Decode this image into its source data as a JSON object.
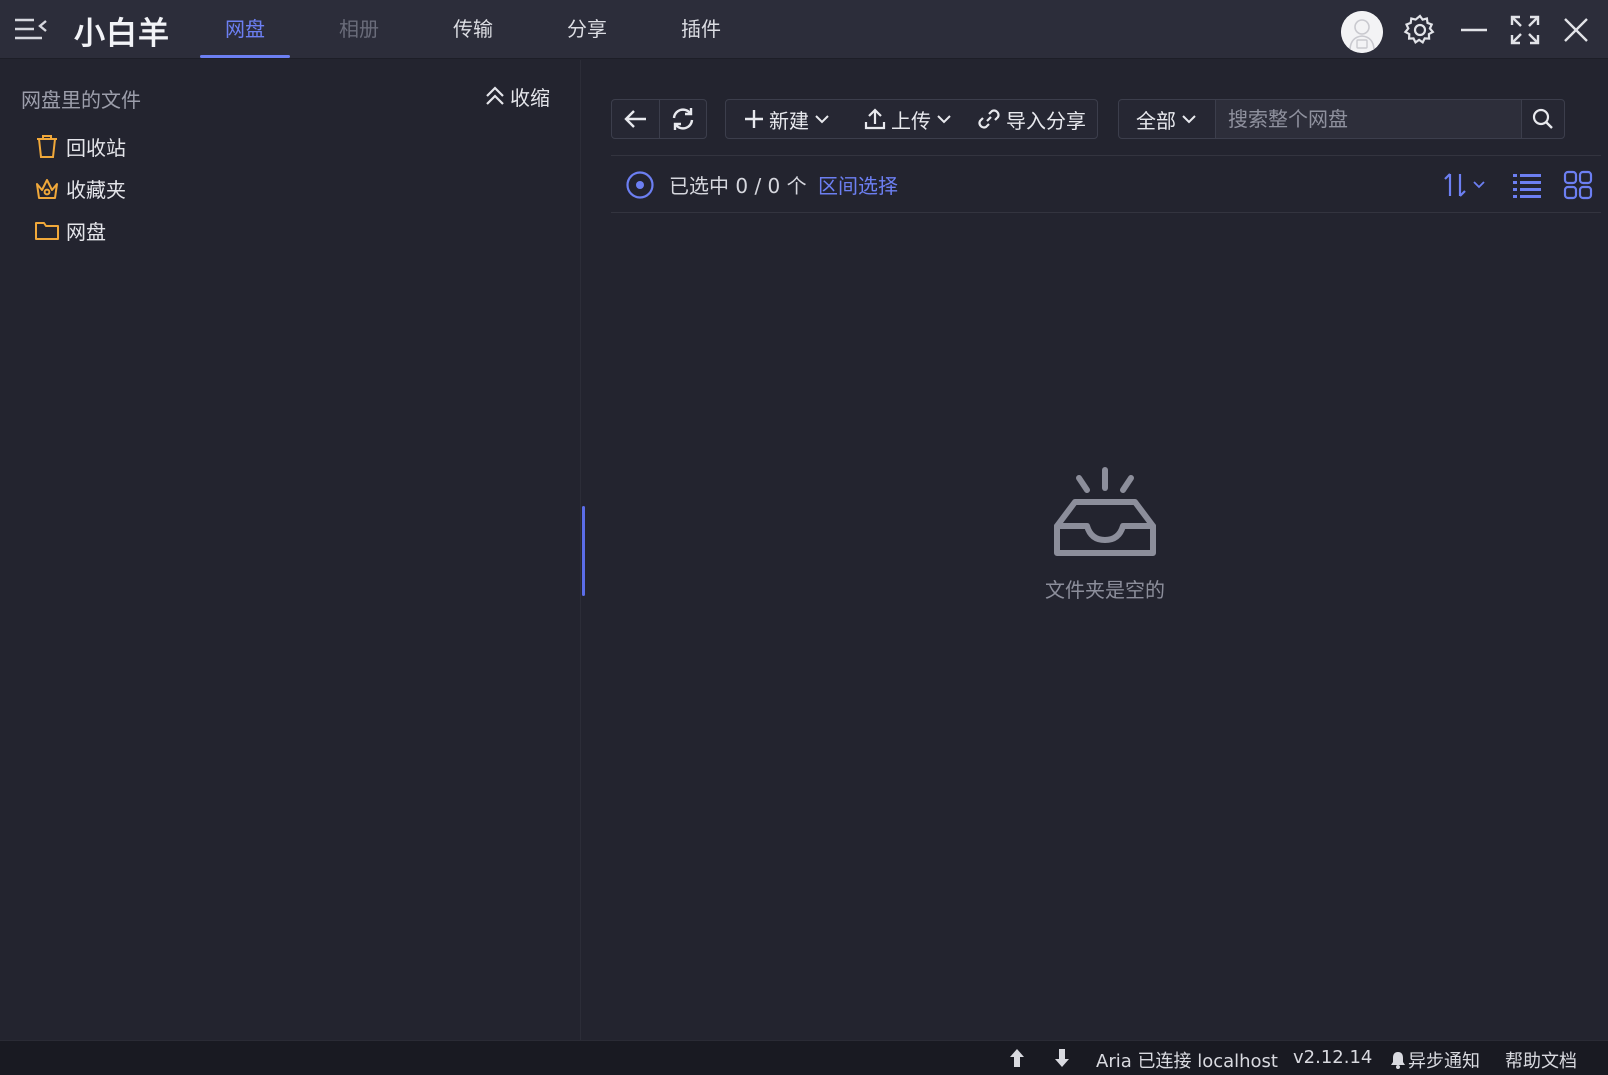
{
  "app": {
    "title": "小白羊"
  },
  "tabs": [
    {
      "label": "网盘",
      "state": "active"
    },
    {
      "label": "相册",
      "state": "disabled"
    },
    {
      "label": "传输",
      "state": "normal"
    },
    {
      "label": "分享",
      "state": "normal"
    },
    {
      "label": "插件",
      "state": "normal"
    }
  ],
  "colors": {
    "accent": "#6c7ff2",
    "folder": "#f0a83a",
    "background": "#23242f",
    "titlebar": "#2c2d3a"
  },
  "sidebar": {
    "header": "网盘里的文件",
    "collapse_label": "收缩",
    "items": [
      {
        "label": "回收站",
        "icon": "trash-icon"
      },
      {
        "label": "收藏夹",
        "icon": "crown-icon"
      },
      {
        "label": "网盘",
        "icon": "folder-icon"
      }
    ]
  },
  "toolbar": {
    "new_label": "新建",
    "upload_label": "上传",
    "import_share_label": "导入分享",
    "filter_label": "全部",
    "search_placeholder": "搜索整个网盘"
  },
  "selection": {
    "text": "已选中 0 / 0 个",
    "range_select_label": "区间选择"
  },
  "empty": {
    "message": "文件夹是空的"
  },
  "status": {
    "aria": "Aria 已连接 localhost",
    "version": "v2.12.14",
    "sync_notice": "异步通知",
    "help": "帮助文档"
  }
}
